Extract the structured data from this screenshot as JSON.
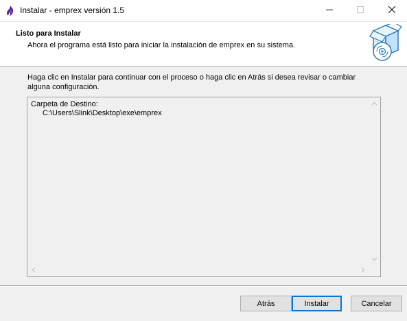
{
  "window": {
    "title": "Instalar - emprex versión 1.5",
    "app_icon": "flame-icon",
    "controls": [
      "minimize-icon",
      "maximize-icon",
      "close-icon"
    ]
  },
  "header": {
    "title": "Listo para Instalar",
    "subtitle": "Ahora el programa está listo para iniciar la instalación de emprex en su sistema.",
    "image": "setup-box-disc-icon"
  },
  "body": {
    "instruction": "Haga clic en Instalar para continuar con el proceso o haga clic en Atrás si desea revisar o cambiar alguna configuración."
  },
  "memo": {
    "line1": "Carpeta de Destino:",
    "line2": "C:\\Users\\Slink\\Desktop\\exe\\emprex"
  },
  "buttons": {
    "back": "Atrás",
    "install": "Instalar",
    "cancel": "Cancelar"
  },
  "colors": {
    "accent": "#0078d7",
    "background": "#f0f0f0",
    "header_bg": "#ffffff"
  }
}
